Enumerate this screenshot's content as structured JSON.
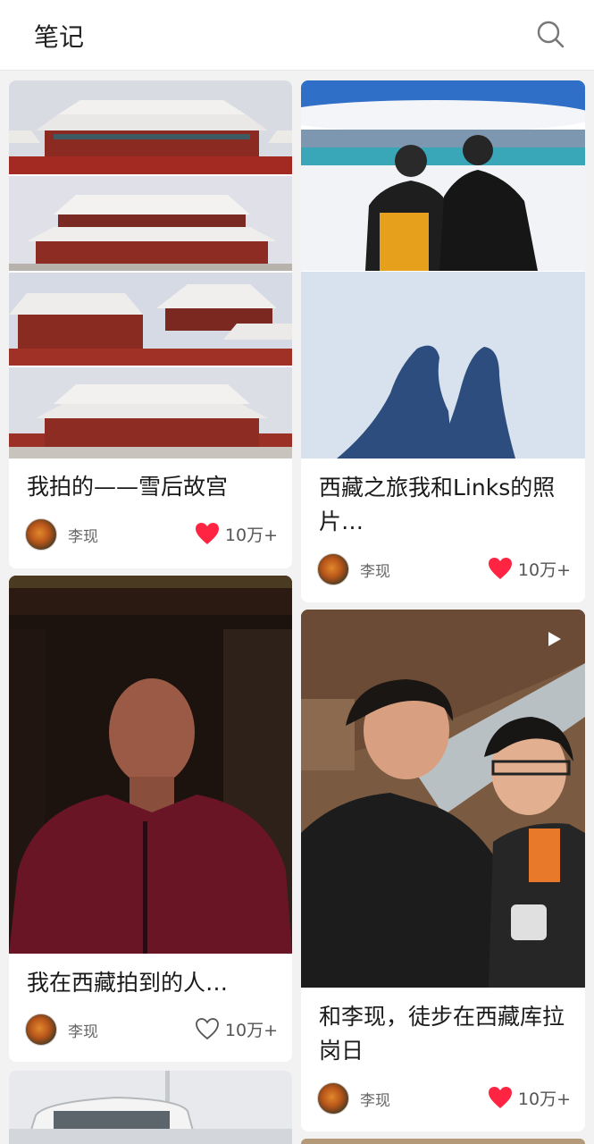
{
  "header": {
    "title": "笔记",
    "search_icon": "search-icon"
  },
  "notes": [
    {
      "title": "我拍的——雪后故宫",
      "author": "李现",
      "likes": "10万+",
      "liked": true
    },
    {
      "title": "西藏之旅我和Links的照片…",
      "author": "李现",
      "likes": "10万+",
      "liked": true
    },
    {
      "title": "我在西藏拍到的人…",
      "author": "李现",
      "likes": "10万+",
      "liked": false
    },
    {
      "title": "和李现，徒步在西藏库拉岗日",
      "author": "李现",
      "likes": "10万+",
      "liked": true,
      "video": true
    }
  ],
  "colors": {
    "heart_filled": "#ff2442",
    "heart_outline": "#555555",
    "background": "#f2f2f2"
  }
}
